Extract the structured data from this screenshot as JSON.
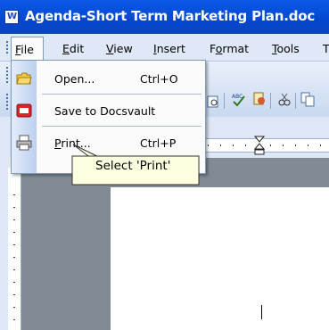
{
  "titlebar": {
    "title": "Agenda-Short Term Marketing Plan.doc",
    "app_icon_glyph": "W"
  },
  "menubar": {
    "items": [
      {
        "label": "File",
        "mnemonic": "F"
      },
      {
        "label": "Edit",
        "mnemonic": "E"
      },
      {
        "label": "View",
        "mnemonic": "V"
      },
      {
        "label": "Insert",
        "mnemonic": "I"
      },
      {
        "label": "Format",
        "mnemonic": "o"
      },
      {
        "label": "Tools",
        "mnemonic": "T"
      },
      {
        "label": "T"
      }
    ]
  },
  "toolbar": {
    "style_fragment": "ow"
  },
  "file_menu": {
    "items": [
      {
        "label": "Open...",
        "shortcut": "Ctrl+O",
        "icon": "open-folder-icon"
      },
      {
        "label": "Save to Docsvault",
        "shortcut": "",
        "icon": "docsvault-icon"
      },
      {
        "label": "Print...",
        "shortcut": "Ctrl+P",
        "icon": "printer-icon"
      }
    ]
  },
  "tooltip": {
    "text": "Select 'Print'"
  },
  "colors": {
    "titlebar": "#0347cf",
    "menubar": "#dfe8f6",
    "canvas": "#808b96",
    "tooltip_bg": "#ffffe1"
  }
}
